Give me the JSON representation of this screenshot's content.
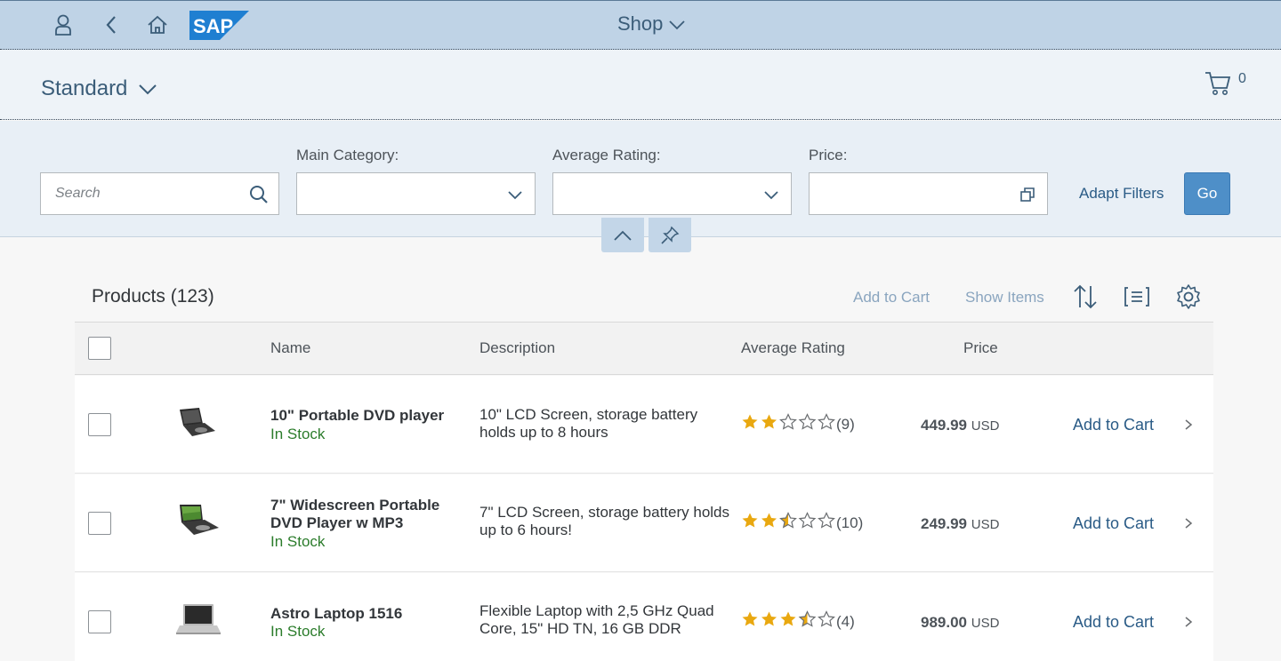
{
  "shell": {
    "title": "Shop",
    "logo_text": "SAP",
    "icons": [
      "user-icon",
      "back-icon",
      "home-icon"
    ]
  },
  "header": {
    "variant": "Standard",
    "cart_count": "0"
  },
  "filters": {
    "search_placeholder": "Search",
    "main_category_label": "Main Category:",
    "average_rating_label": "Average Rating:",
    "price_label": "Price:",
    "adapt_filters": "Adapt Filters",
    "go": "Go"
  },
  "table": {
    "title": "Products (123)",
    "actions": {
      "add_to_cart": "Add to Cart",
      "show_items": "Show Items"
    },
    "columns": {
      "name": "Name",
      "description": "Description",
      "rating": "Average Rating",
      "price": "Price"
    },
    "rows": [
      {
        "name": "10\" Portable DVD player",
        "stock": "In Stock",
        "description": "10\" LCD Screen, storage battery holds up to 8 hours",
        "rating": 2,
        "rating_count": "(9)",
        "price": "449.99",
        "currency": "USD",
        "action": "Add to Cart"
      },
      {
        "name": "7\" Widescreen Portable DVD Player w MP3",
        "stock": "In Stock",
        "description": "7\" LCD Screen, storage battery holds up to 6 hours!",
        "rating": 2.5,
        "rating_count": "(10)",
        "price": "249.99",
        "currency": "USD",
        "action": "Add to Cart"
      },
      {
        "name": "Astro Laptop 1516",
        "stock": "In Stock",
        "description": "Flexible Laptop with 2,5 GHz Quad Core, 15\" HD TN, 16 GB DDR",
        "rating": 3.5,
        "rating_count": "(4)",
        "price": "989.00",
        "currency": "USD",
        "action": "Add to Cart"
      }
    ]
  },
  "colors": {
    "shell": "#bfd3e6",
    "accent": "#4e8fc8",
    "link": "#2a5b86",
    "star": "#e9a810",
    "success": "#2b7c2b"
  }
}
